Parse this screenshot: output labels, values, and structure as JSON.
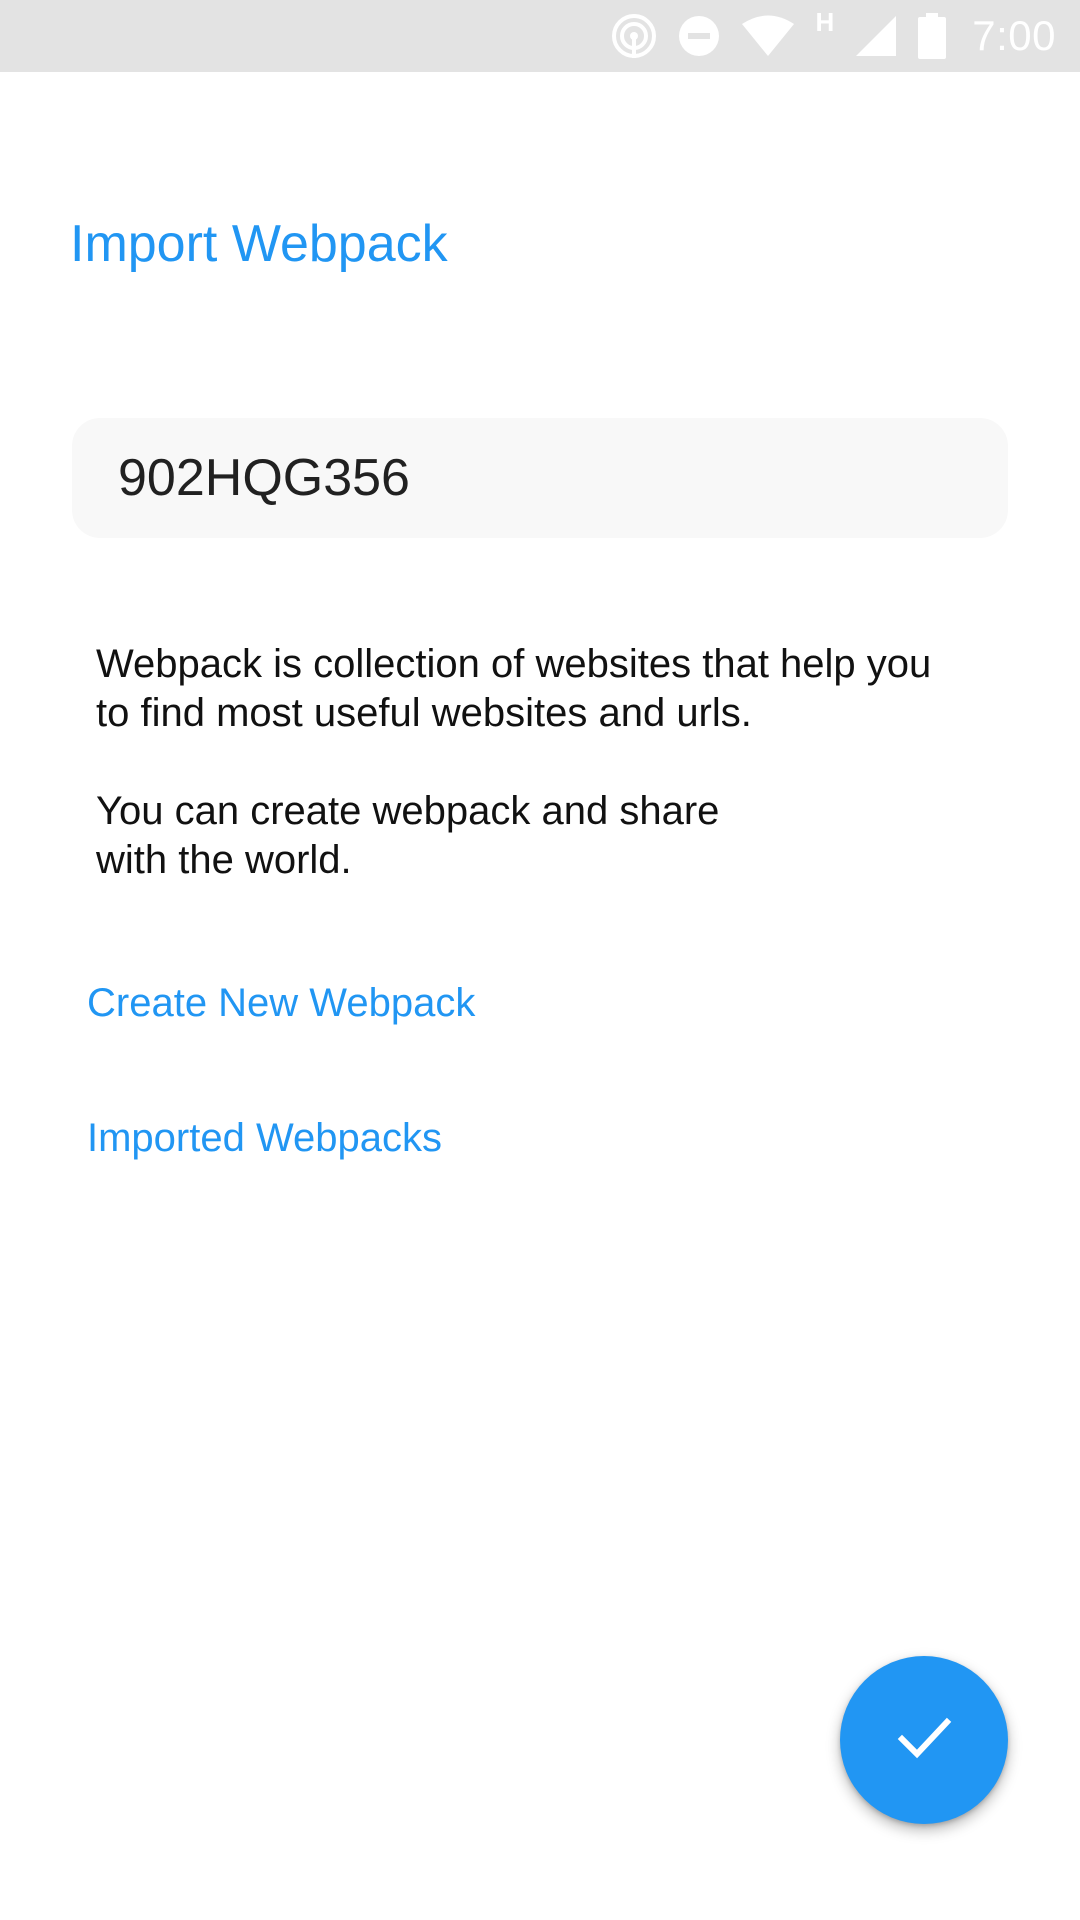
{
  "status_bar": {
    "time": "7:00",
    "network_type": "H",
    "icons": [
      "hotspot-icon",
      "do-not-disturb-icon",
      "wifi-icon",
      "cell-signal-icon",
      "battery-icon"
    ]
  },
  "page": {
    "title": "Import Webpack"
  },
  "code_field": {
    "value": "902HQG356"
  },
  "description": {
    "paragraph1_line1": "Webpack is collection of websites that help you",
    "paragraph1_line2": "to find most useful websites and urls.",
    "paragraph2_line1": "You can create webpack and share",
    "paragraph2_line2": "with the world."
  },
  "links": {
    "create_new": "Create New Webpack",
    "imported": "Imported Webpacks"
  },
  "fab": {
    "icon": "check-icon"
  },
  "colors": {
    "accent": "#2196f3",
    "status_bar": "#e3e3e3",
    "field_background": "#f8f8f8"
  }
}
